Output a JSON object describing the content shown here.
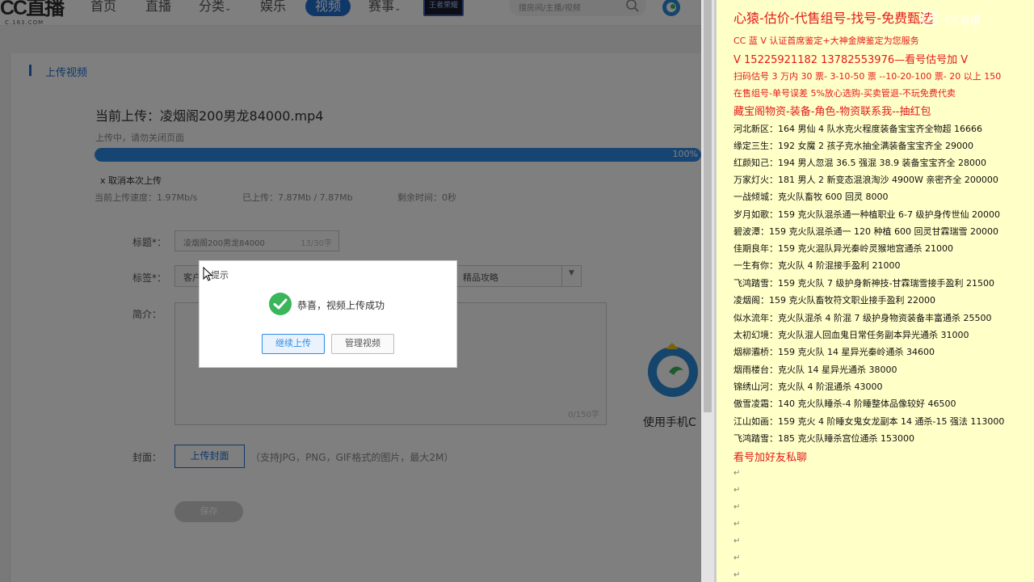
{
  "nav": {
    "logo_text": "CC直播",
    "logo_sub": "C.163.COM",
    "items": [
      {
        "label": "首页"
      },
      {
        "label": "直播"
      },
      {
        "label": "分类"
      },
      {
        "label": "娱乐"
      },
      {
        "label": "视频"
      },
      {
        "label": "赛事"
      }
    ],
    "badge_text": "王者荣耀S6",
    "search_placeholder": "搜房间/主播/视频"
  },
  "section": {
    "title": "上传视频"
  },
  "upload": {
    "title": "当前上传：凌烟阁200男龙84000.mp4",
    "note": "上传中，请勿关闭页面",
    "progress_percent": 100,
    "progress_label": "100%",
    "cancel_label": "x 取消本次上传",
    "speed": "当前上传速度：1.97Mb/s",
    "uploaded": "已上传：7.87Mb / 7.87Mb",
    "remaining": "剩余时间：0秒"
  },
  "form": {
    "title_label": "标题*：",
    "title_value": "凌烟阁200男龙84000",
    "title_count": "13/30字",
    "tags_label": "标签*：",
    "tag_first": "客户",
    "tag_selected": "精品攻略",
    "desc_label": "简介：",
    "desc_count": "0/150字",
    "cover_label": "封面：",
    "cover_button": "上传封面",
    "cover_hint": "（支持JPG，PNG，GIF格式的图片，最大2M）",
    "save_button": "保存"
  },
  "app_promo": {
    "label": "使用手机C"
  },
  "dialog": {
    "hint": "提示",
    "message": "恭喜，视频上传成功",
    "primary_button": "继续上传",
    "secondary_button": "管理视频"
  },
  "notes": {
    "title": "心猿-估价-代售组号-找号-免费甄选",
    "red_lines": [
      "CC 蓝 V 认证首席鉴定+大神金牌鉴定为您服务",
      "V 15225921182      13782553976—看号估号加 V",
      "扫码估号 3 万内 30 票- 3-10-50 票  --10-20-100 票- 20 以上 150",
      "在售组号-单号误差 5%放心选购-买卖管退-不玩免费代卖",
      "藏宝阁物资-装备-角色-物资联系我--抽红包"
    ],
    "listings": [
      "河北新区：164 男仙 4 队水克火程度装备宝宝齐全物超 16666",
      "缘定三生：192 女魔 2 孩子克水抽全满装备宝宝齐全 29000",
      "红颜知己：194 男人忽混 36.5 强混 38.9 装备宝宝齐全 28000",
      "万家灯火：181 男人 2 新变态混浪淘沙 4900W 亲密齐全 200000",
      "一战倾城：克火队畜牧 600 回灵 8000",
      "岁月如歌：159 克火队混杀通一种植职业 6-7 级护身传世仙 20000",
      "碧波潭：159 克火队混杀通一 120 种植 600 回灵甘霖瑞雪 20000",
      "佳期良年：159 克火混队异光秦岭灵猴地宫通杀 21000",
      "一生有你：克火队 4 阶混接手盈利 21000",
      "飞鸿踏雪：159 克火队 7 级护身新神技-甘霖瑞雪接手盈利 21500",
      "凌烟阁：159 克火队畜牧符文职业接手盈利 22000",
      "似水流年：克火队混杀 4 阶混 7 级护身物资装备丰富通杀 25500",
      "太初幻境：克火队混人回血鬼日常任务副本异光通杀 31000",
      "烟柳灞桥：159 克火队 14 星异光秦岭通杀 34600",
      "烟雨楼台：克火队 14 星异光通杀 38000",
      "锦绣山河：克火队 4 阶混通杀 43000",
      "傲雪凌霜：140 克火队睡杀-4 阶睡整体品像较好 46500",
      "江山如画：159 克火 4 阶睡女鬼女龙副本 14 通杀-15 强法 113000",
      "飞鸿踏雪：185 克火队睡杀宫位通杀 153000"
    ],
    "footer": "看号加好友私聊",
    "watermark": "CC直播"
  }
}
